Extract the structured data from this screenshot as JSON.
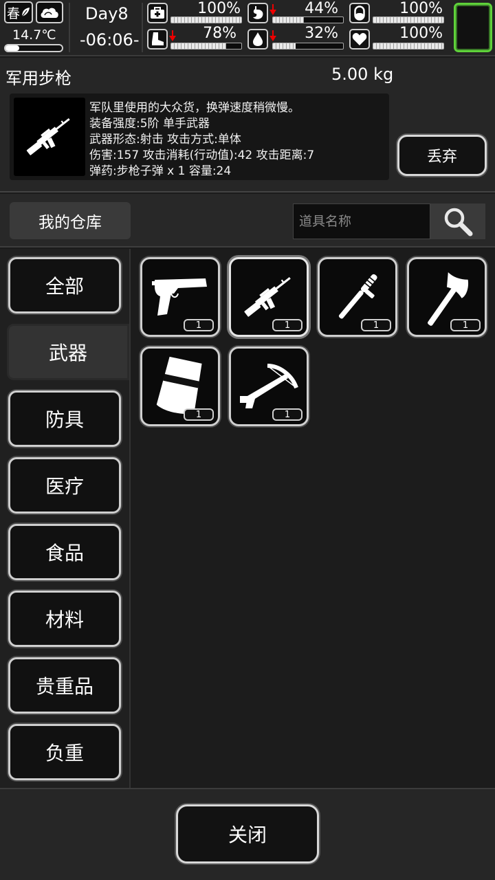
{
  "hud": {
    "season": "春",
    "temperature": "14.7℃",
    "day": "Day8",
    "time": "-06:06-",
    "stats": [
      {
        "name": "health",
        "icon": "medkit-icon",
        "value": "100%",
        "level": 1.0,
        "dropping": false
      },
      {
        "name": "hunger",
        "icon": "stomach-icon",
        "value": "44%",
        "level": 0.44,
        "dropping": true
      },
      {
        "name": "medicine",
        "icon": "pill-icon",
        "value": "100%",
        "level": 1.0,
        "dropping": false
      },
      {
        "name": "stamina",
        "icon": "boot-icon",
        "value": "78%",
        "level": 0.78,
        "dropping": true
      },
      {
        "name": "thirst",
        "icon": "water-drop-icon",
        "value": "32%",
        "level": 0.32,
        "dropping": true
      },
      {
        "name": "mood",
        "icon": "heart-icon",
        "value": "100%",
        "level": 1.0,
        "dropping": false
      }
    ],
    "accent_color": "#5fd23a"
  },
  "item": {
    "name": "军用步枪",
    "weight": "5.00 kg",
    "icon": "rifle-icon",
    "description": [
      "军队里使用的大众货，换弹速度稍微慢。",
      "装备强度:5阶 单手武器",
      "武器形态:射击 攻击方式:单体",
      " 伤害:157 攻击消耗(行动值):42 攻击距离:7",
      "弹药:步枪子弹 x 1 容量:24"
    ],
    "discard_label": "丢弃"
  },
  "warehouse": {
    "title": "我的仓库",
    "search_placeholder": "道具名称"
  },
  "categories": [
    {
      "label": "全部",
      "active": false
    },
    {
      "label": "武器",
      "active": true
    },
    {
      "label": "防具",
      "active": false
    },
    {
      "label": "医疗",
      "active": false
    },
    {
      "label": "食品",
      "active": false
    },
    {
      "label": "材料",
      "active": false
    },
    {
      "label": "贵重品",
      "active": false
    },
    {
      "label": "负重",
      "active": false
    }
  ],
  "items": [
    {
      "icon": "pistol-icon",
      "count": "1",
      "selected": false
    },
    {
      "icon": "rifle-icon",
      "count": "1",
      "selected": true
    },
    {
      "icon": "baton-icon",
      "count": "1",
      "selected": false
    },
    {
      "icon": "axe-icon",
      "count": "1",
      "selected": false
    },
    {
      "icon": "riot-shield-icon",
      "count": "1",
      "selected": false
    },
    {
      "icon": "crossbow-icon",
      "count": "1",
      "selected": false
    }
  ],
  "footer": {
    "close_label": "关闭"
  }
}
